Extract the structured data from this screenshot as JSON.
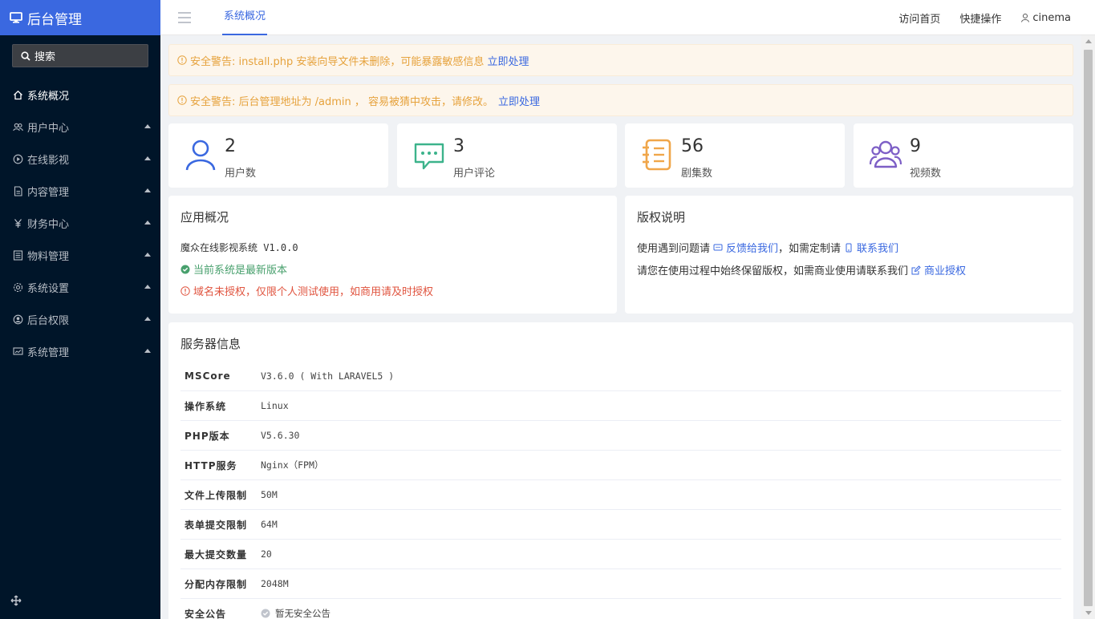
{
  "app": {
    "title": "后台管理"
  },
  "sidebar": {
    "search_label": "搜索",
    "items": [
      {
        "label": "系统概况",
        "icon": "home-icon"
      },
      {
        "label": "用户中心",
        "icon": "users-icon"
      },
      {
        "label": "在线影视",
        "icon": "play-circle-icon"
      },
      {
        "label": "内容管理",
        "icon": "document-icon"
      },
      {
        "label": "财务中心",
        "icon": "yen-icon"
      },
      {
        "label": "物料管理",
        "icon": "list-icon"
      },
      {
        "label": "系统设置",
        "icon": "gear-icon"
      },
      {
        "label": "后台权限",
        "icon": "user-circle-icon"
      },
      {
        "label": "系统管理",
        "icon": "monitor-icon"
      }
    ]
  },
  "header": {
    "tab": "系统概况",
    "nav": {
      "home": "访问首页",
      "quick": "快捷操作",
      "user": "cinema"
    }
  },
  "alerts": [
    {
      "text": "安全警告: install.php 安装向导文件未删除，可能暴露敏感信息",
      "link": "立即处理"
    },
    {
      "text": "安全警告: 后台管理地址为 /admin ， 容易被猜中攻击，请修改。",
      "link": "立即处理"
    }
  ],
  "stats": [
    {
      "value": "2",
      "label": "用户数",
      "icon": "user-icon",
      "color": "#3a68e0"
    },
    {
      "value": "3",
      "label": "用户评论",
      "icon": "comment-icon",
      "color": "#3cb38b"
    },
    {
      "value": "56",
      "label": "剧集数",
      "icon": "notebook-icon",
      "color": "#f0a64a"
    },
    {
      "value": "9",
      "label": "视频数",
      "icon": "group-icon",
      "color": "#7d5fc6"
    }
  ],
  "app_overview": {
    "title": "应用概况",
    "version": "魔众在线影视系统 V1.0.0",
    "latest": "当前系统是最新版本",
    "unauthorized": "域名未授权，仅限个人测试使用，如商用请及时授权"
  },
  "copyright": {
    "title": "版权说明",
    "line1_prefix": "使用遇到问题请",
    "feedback": "反馈给我们",
    "line1_mid": "，如需定制请",
    "contact": "联系我们",
    "line2_prefix": "请您在使用过程中始终保留版权，如需商业使用请联系我们",
    "license": "商业授权"
  },
  "server": {
    "title": "服务器信息",
    "rows": [
      {
        "k": "MSCore",
        "v": "V3.6.0 ( With LARAVEL5 )"
      },
      {
        "k": "操作系统",
        "v": "Linux"
      },
      {
        "k": "PHP版本",
        "v": "V5.6.30"
      },
      {
        "k": "HTTP服务",
        "v": "Nginx（FPM）"
      },
      {
        "k": "文件上传限制",
        "v": "50M"
      },
      {
        "k": "表单提交限制",
        "v": "64M"
      },
      {
        "k": "最大提交数量",
        "v": "20"
      },
      {
        "k": "分配内存限制",
        "v": "2048M"
      },
      {
        "k": "安全公告",
        "v": "暂无安全公告"
      }
    ]
  },
  "colors": {
    "accent": "#3a68e0",
    "sidebar": "#001529",
    "warning": "#e6a23c",
    "success": "#48a06d",
    "danger": "#e0543f"
  }
}
